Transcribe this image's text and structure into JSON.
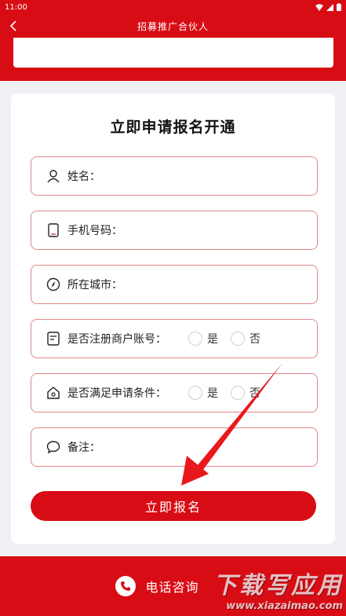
{
  "status_bar": {
    "time": "11:00"
  },
  "nav": {
    "title": "招募推广合伙人"
  },
  "form": {
    "title": "立即申请报名开通",
    "fields": [
      {
        "label": "姓名：",
        "icon": "person-icon"
      },
      {
        "label": "手机号码：",
        "icon": "phone-icon"
      },
      {
        "label": "所在城市：",
        "icon": "compass-icon"
      },
      {
        "label": "是否注册商户账号：",
        "icon": "document-icon",
        "options": [
          "是",
          "否"
        ]
      },
      {
        "label": "是否满足申请条件：",
        "icon": "home-icon",
        "options": [
          "是",
          "否"
        ]
      },
      {
        "label": "备注：",
        "icon": "chat-icon"
      }
    ],
    "submit_label": "立即报名"
  },
  "bottom": {
    "phone_label": "电话咨询",
    "icon": "phone-handset-icon"
  },
  "watermark": {
    "title": "下载写应用",
    "url": "www.xiazaimao.com"
  },
  "colors": {
    "brand": "#d80c14",
    "field_border": "#e2868a",
    "page_bg": "#f0f1f5"
  }
}
